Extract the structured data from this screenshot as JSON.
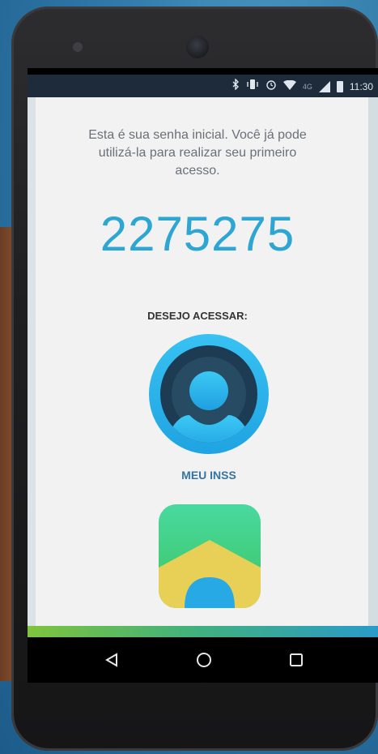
{
  "status_bar": {
    "network_label": "4G",
    "time": "11:30",
    "icons": [
      "bluetooth-icon",
      "vibrate-icon",
      "alarm-icon",
      "wifi-icon",
      "signal-icon",
      "battery-icon"
    ]
  },
  "intro_text": "Esta é sua senha inicial. Você já pode utilizá-la para realizar seu primeiro acesso.",
  "password_code": "2275275",
  "access_label": "DESEJO ACESSAR:",
  "apps": [
    {
      "label": "MEU INSS",
      "icon": "meu-inss-app-icon"
    },
    {
      "label": "",
      "icon": "second-app-icon"
    }
  ],
  "nav": {
    "back": "back-icon",
    "home": "home-icon",
    "recents": "recents-icon"
  },
  "colors": {
    "code": "#2ea6d3",
    "app_label": "#3575a6",
    "accent_start": "#7fc43c",
    "accent_end": "#2a9bc8"
  }
}
